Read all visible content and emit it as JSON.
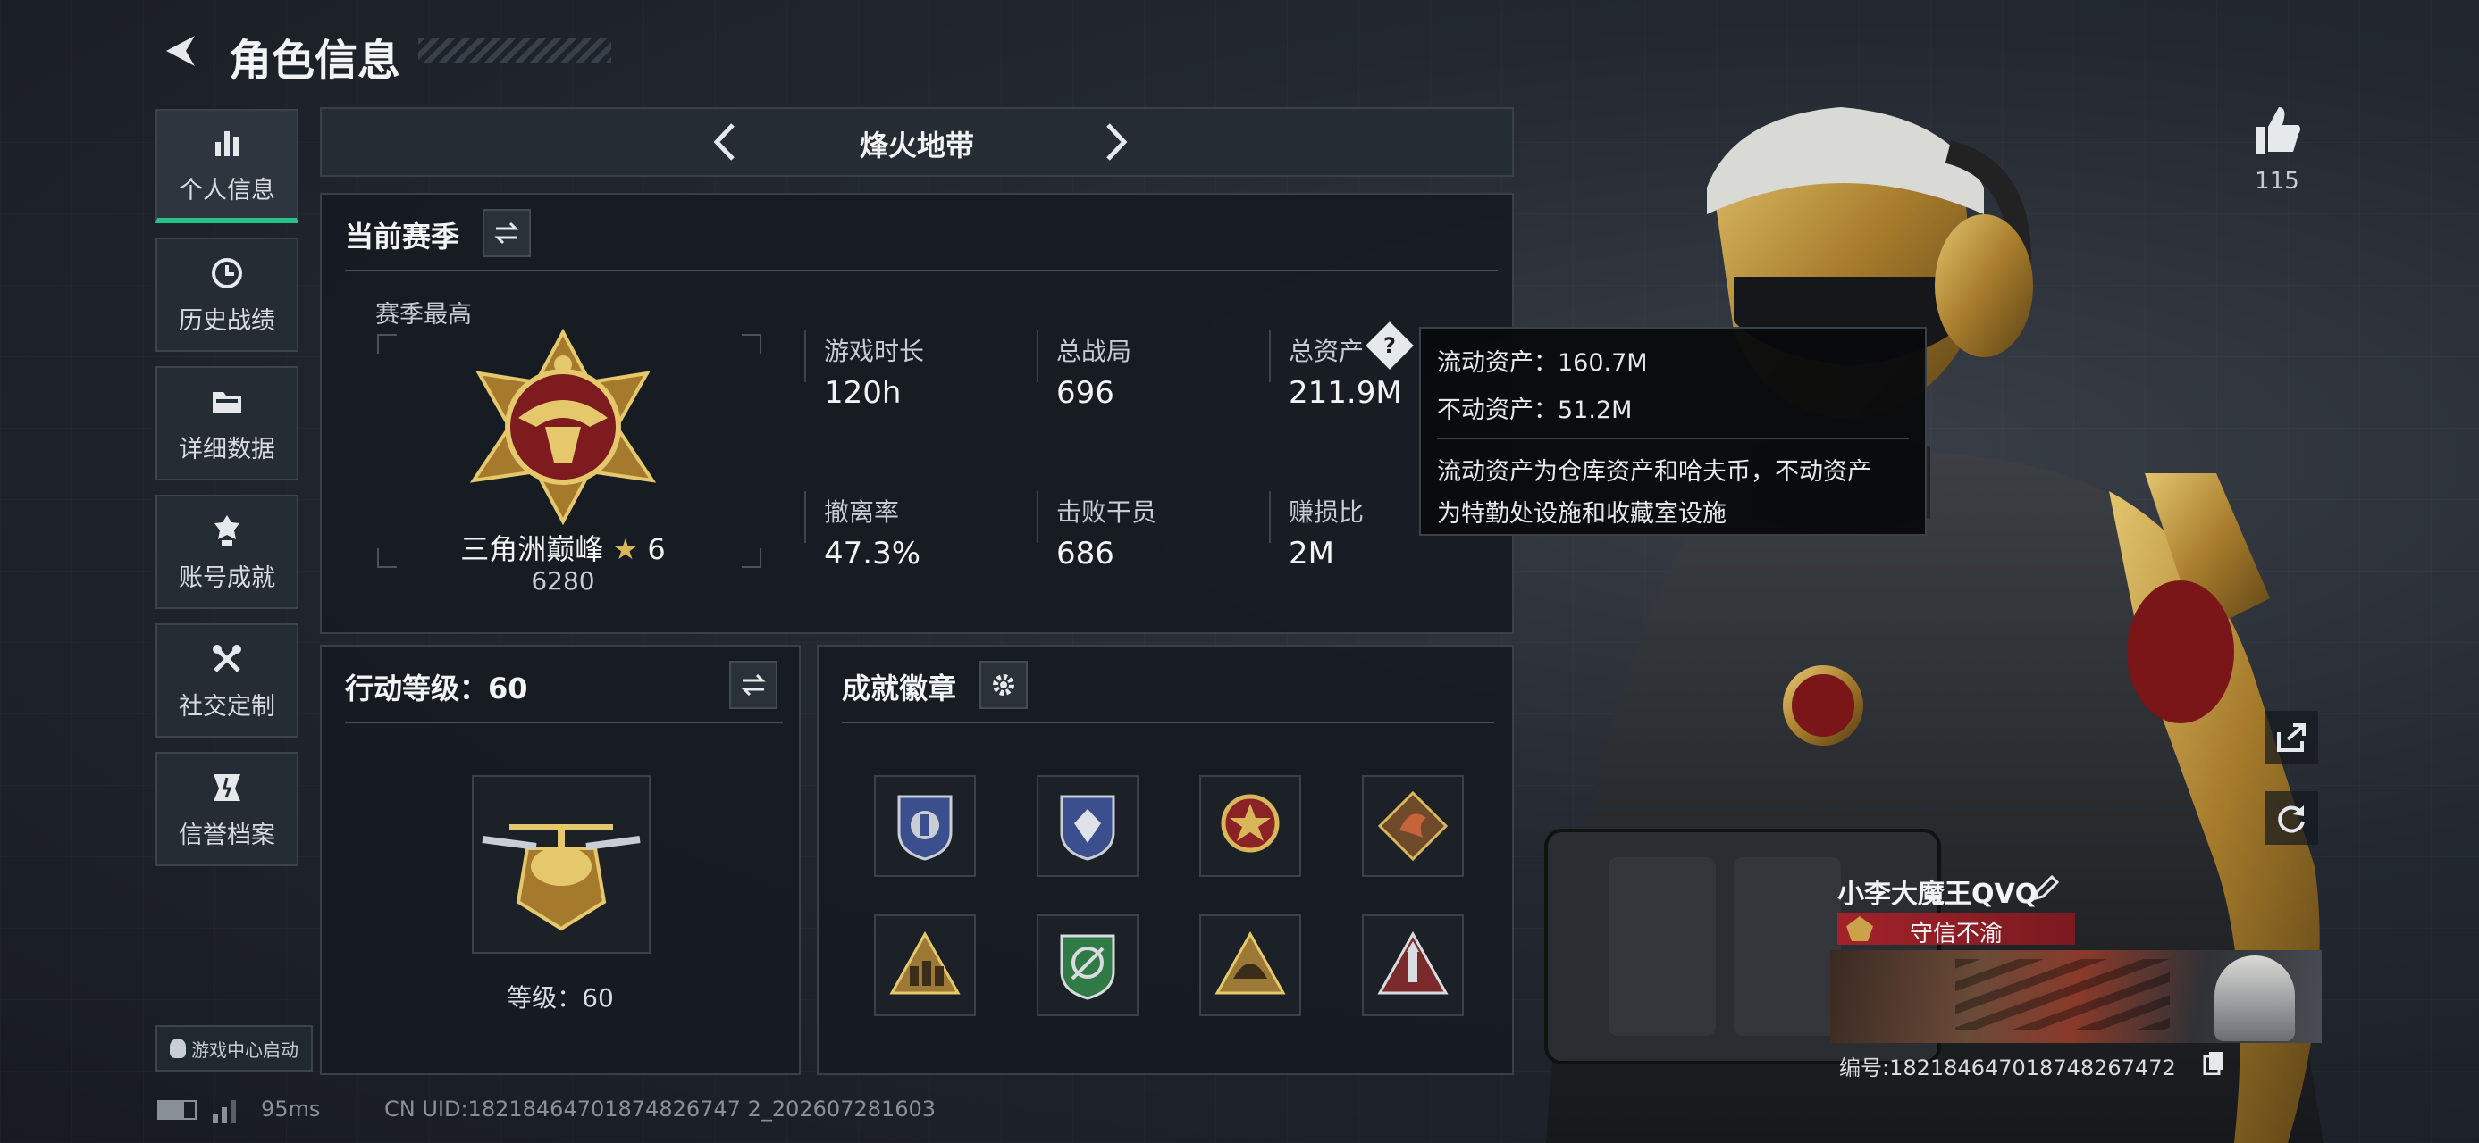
{
  "header": {
    "title": "角色信息"
  },
  "sidebar": {
    "items": [
      {
        "label": "个人信息",
        "icon": "bar-chart-icon",
        "active": true
      },
      {
        "label": "历史战绩",
        "icon": "history-icon"
      },
      {
        "label": "详细数据",
        "icon": "folder-icon"
      },
      {
        "label": "账号成就",
        "icon": "achievement-icon"
      },
      {
        "label": "社交定制",
        "icon": "tools-icon"
      },
      {
        "label": "信誉档案",
        "icon": "credit-icon"
      }
    ],
    "game_center": "游戏中心启动"
  },
  "mode_selector": {
    "label": "烽火地带"
  },
  "season": {
    "title": "当前赛季",
    "subtitle": "赛季最高",
    "rank_name": "三角洲巅峰",
    "rank_stars": "6",
    "rank_score": "6280",
    "stats": [
      {
        "label": "游戏时长",
        "value": "120h"
      },
      {
        "label": "总战局",
        "value": "696"
      },
      {
        "label": "总资产",
        "value": "211.9M"
      },
      {
        "label": "撤离率",
        "value": "47.3%"
      },
      {
        "label": "击败干员",
        "value": "686"
      },
      {
        "label": "赚损比",
        "value": "2M"
      }
    ]
  },
  "tooltip": {
    "liquid": "流动资产：160.7M",
    "fixed": "不动资产：51.2M",
    "desc1": "流动资产为仓库资产和哈夫币，不动资产",
    "desc2": "为特勤处设施和收藏室设施"
  },
  "action_level": {
    "title": "行动等级：60",
    "level_text": "等级：60"
  },
  "achievements": {
    "title": "成就徽章"
  },
  "likes": {
    "count": "115"
  },
  "profile": {
    "name": "小李大魔王QVQ",
    "honor": "守信不渝",
    "id_text": "编号:1821846470187482674​72"
  },
  "status_bar": {
    "ping": "95ms",
    "uid": "CN UID:18218464701874826747 2_202607281603"
  },
  "colors": {
    "accent_green": "#28c08a",
    "honor_red": "#a3222a",
    "gold": "#c9a24a"
  }
}
